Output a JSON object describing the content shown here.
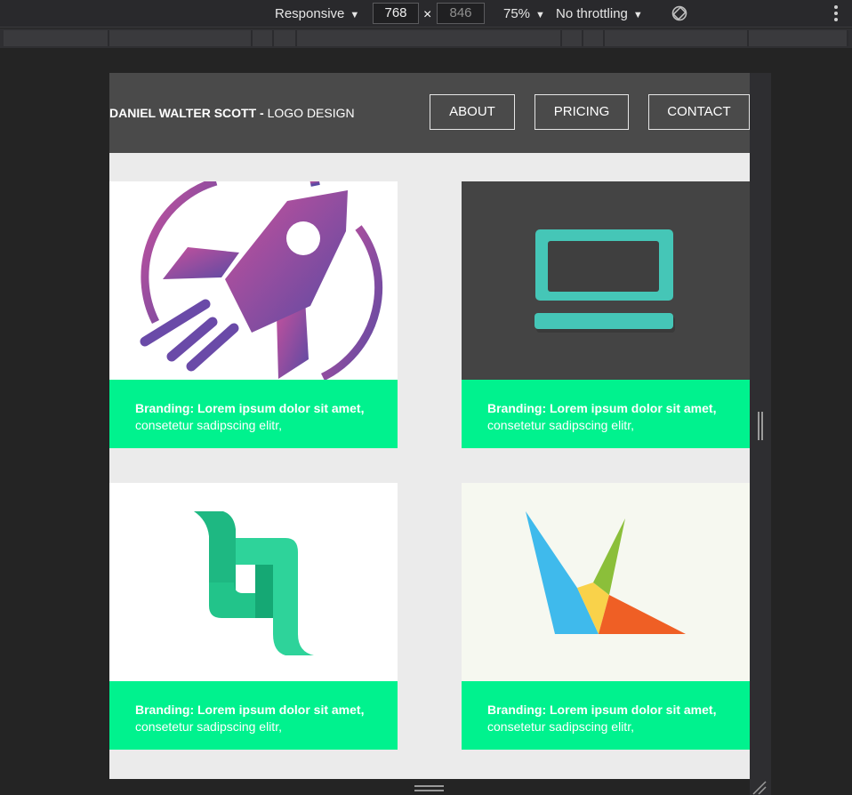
{
  "devtools": {
    "device_mode": "Responsive",
    "width": "768",
    "times": "×",
    "height": "846",
    "zoom": "75%",
    "throttling": "No throttling",
    "caret": "▼",
    "icons": [
      "rotate-icon",
      "more-options-icon"
    ]
  },
  "site": {
    "brand_name": "DANIEL WALTER SCOTT -",
    "brand_suffix": "LOGO DESIGN",
    "nav": [
      {
        "label": "ABOUT"
      },
      {
        "label": "PRICING"
      },
      {
        "label": "CONTACT"
      }
    ],
    "cards": [
      {
        "art": "rocket-logo",
        "title": "Branding: Lorem ipsum dolor sit amet,",
        "subtitle": "consetetur sadipscing elitr,"
      },
      {
        "art": "laptop-logo",
        "title": "Branding: Lorem ipsum dolor sit amet,",
        "subtitle": "consetetur sadipscing elitr,"
      },
      {
        "art": "ribbon-letter-logo",
        "title": "Branding: Lorem ipsum dolor sit amet,",
        "subtitle": "consetetur sadipscing elitr,"
      },
      {
        "art": "bird-triangle-logo",
        "title": "Branding: Lorem ipsum dolor sit amet,",
        "subtitle": "consetetur sadipscing elitr,"
      }
    ]
  },
  "colors": {
    "header_bg": "#4a4a4a",
    "page_bg": "#ebebeb",
    "caption_green": "#00f28e",
    "laptop_teal": "#45c6b7",
    "ribbon_green": "#22c48a"
  }
}
